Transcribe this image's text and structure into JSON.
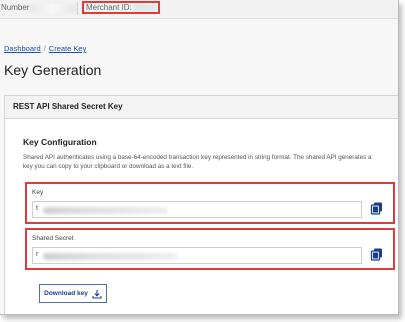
{
  "topbar": {
    "number_label": "Number",
    "merchant_label": "Merchant ID:"
  },
  "breadcrumb": {
    "items": [
      "Dashboard",
      "Create Key"
    ],
    "separator": "/"
  },
  "page_title": "Key Generation",
  "panel": {
    "title": "REST API Shared Secret Key",
    "config_title": "Key Configuration",
    "description": "Shared API authenticates using a base-64-encoded transaction key represented in string format. The shared API generates a key you can copy to your clipboard or download as a text file.",
    "key_field": {
      "label": "Key",
      "first_char": "t"
    },
    "secret_field": {
      "label": "Shared Secret",
      "first_char": "r"
    },
    "download_label": "Download key"
  },
  "colors": {
    "highlight": "#e03b3b",
    "link": "#1a52a8",
    "icon": "#1a3f8a"
  },
  "icons": [
    "copy-icon",
    "download-icon"
  ]
}
